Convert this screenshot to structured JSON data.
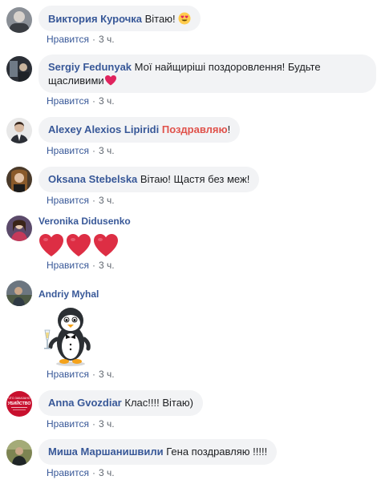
{
  "comments": [
    {
      "name": "Виктория Курочка",
      "text": "Вітаю!",
      "emoji": "heart-eyes-emoji",
      "like": "Нравится",
      "time": "3 ч."
    },
    {
      "name": "Sergiy Fedunyak",
      "text": "Мої найщиріші поздоровлення! Будьте",
      "text2": "щасливими",
      "emoji": "red-heart-emoji",
      "like": "Нравится",
      "time": "3 ч."
    },
    {
      "name": "Alexey Alexios Lipiridi",
      "text": "Поздравляю",
      "text_suffix": "!",
      "like": "Нравится",
      "time": "3 ч."
    },
    {
      "name": "Oksana Stebelska",
      "text": "Вітаю! Щастя без меж!",
      "like": "Нравится",
      "time": "3 ч."
    },
    {
      "name": "Veronika Didusenko",
      "emoji": "three-red-hearts",
      "like": "Нравится",
      "time": "3 ч."
    },
    {
      "name": "Andriy Myhal",
      "sticker": "penguin-champagne-sticker",
      "like": "Нравится",
      "time": "3 ч."
    },
    {
      "name": "Anna Gvozdiar",
      "text": "Клас!!!! Вітаю)",
      "avatar_text": "ЧТО ЗАКАЗАНО УБИЙСТВО",
      "like": "Нравится",
      "time": "3 ч."
    },
    {
      "name": "Миша Маршанишвили",
      "text": "Гена поздравляю !!!!!",
      "like": "Нравится",
      "time": "3 ч."
    }
  ],
  "colors": {
    "name": "#385898",
    "bubble": "#f2f3f5",
    "meta": "#606770",
    "highlight": "#e0524b",
    "heart": "#e0245e"
  }
}
